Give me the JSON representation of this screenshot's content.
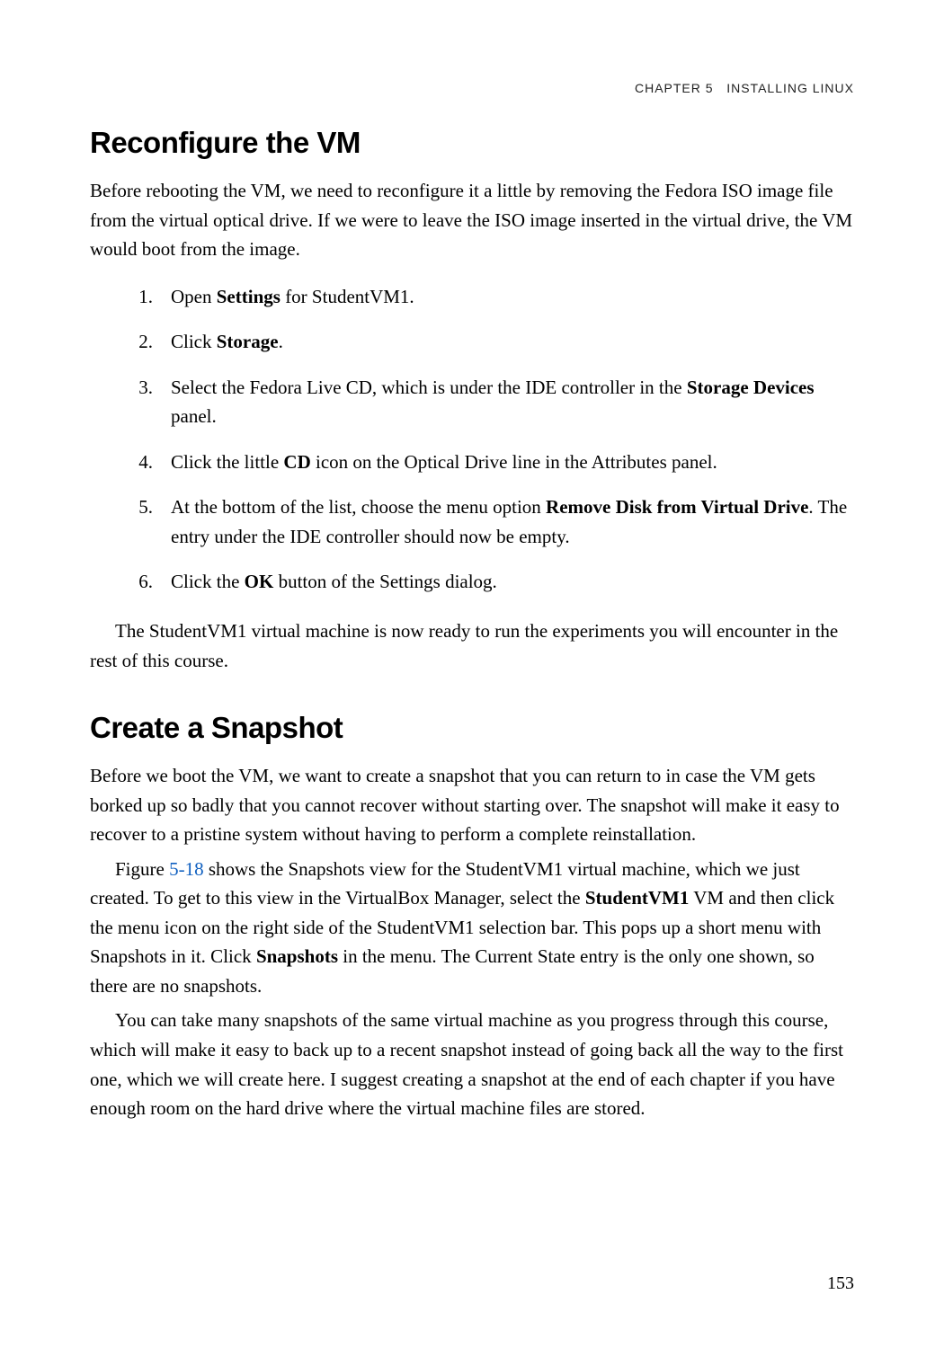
{
  "header": {
    "chapter_label": "CHAPTER 5",
    "chapter_title": "INSTALLING LINUX"
  },
  "section1": {
    "heading": "Reconfigure the VM",
    "intro": "Before rebooting the VM, we need to reconfigure it a little by removing the Fedora ISO image file from the virtual optical drive. If we were to leave the ISO image inserted in the virtual drive, the VM would boot from the image.",
    "steps": [
      {
        "n": "1.",
        "pre": "Open ",
        "b1": "Settings",
        "post": " for StudentVM1."
      },
      {
        "n": "2.",
        "pre": "Click ",
        "b1": "Storage",
        "post": "."
      },
      {
        "n": "3.",
        "pre": "Select the Fedora Live CD, which is under the IDE controller in the ",
        "b1": "Storage Devices",
        "post": " panel."
      },
      {
        "n": "4.",
        "pre": "Click the little ",
        "b1": "CD",
        "post": " icon on the Optical Drive line in the Attributes panel."
      },
      {
        "n": "5.",
        "pre": "At the bottom of the list, choose the menu option ",
        "b1": "Remove Disk from Virtual Drive",
        "post": ". The entry under the IDE controller should now be empty."
      },
      {
        "n": "6.",
        "pre": "Click the ",
        "b1": "OK",
        "post": " button of the Settings dialog."
      }
    ],
    "outro": "The StudentVM1 virtual machine is now ready to run the experiments you will encounter in the rest of this course."
  },
  "section2": {
    "heading": "Create a Snapshot",
    "p1": "Before we boot the VM, we want to create a snapshot that you can return to in case the VM gets borked up so badly that you cannot recover without starting over. The snapshot will make it easy to recover to a pristine system without having to perform a complete reinstallation.",
    "p2_pre": "Figure ",
    "p2_figref": "5-18",
    "p2_mid": " shows the Snapshots view for the StudentVM1 virtual machine, which we just created. To get to this view in the VirtualBox Manager, select the ",
    "p2_b1": "StudentVM1",
    "p2_mid2": " VM and then click the menu icon on the right side of the StudentVM1 selection bar. This pops up a short menu with Snapshots in it. Click ",
    "p2_b2": "Snapshots",
    "p2_post": " in the menu. The Current State entry is the only one shown, so there are no snapshots.",
    "p3": "You can take many snapshots of the same virtual machine as you progress through this course, which will make it easy to back up to a recent snapshot instead of going back all the way to the first one, which we will create here. I suggest creating a snapshot at the end of each chapter if you have enough room on the hard drive where the virtual machine files are stored."
  },
  "page_number": "153"
}
